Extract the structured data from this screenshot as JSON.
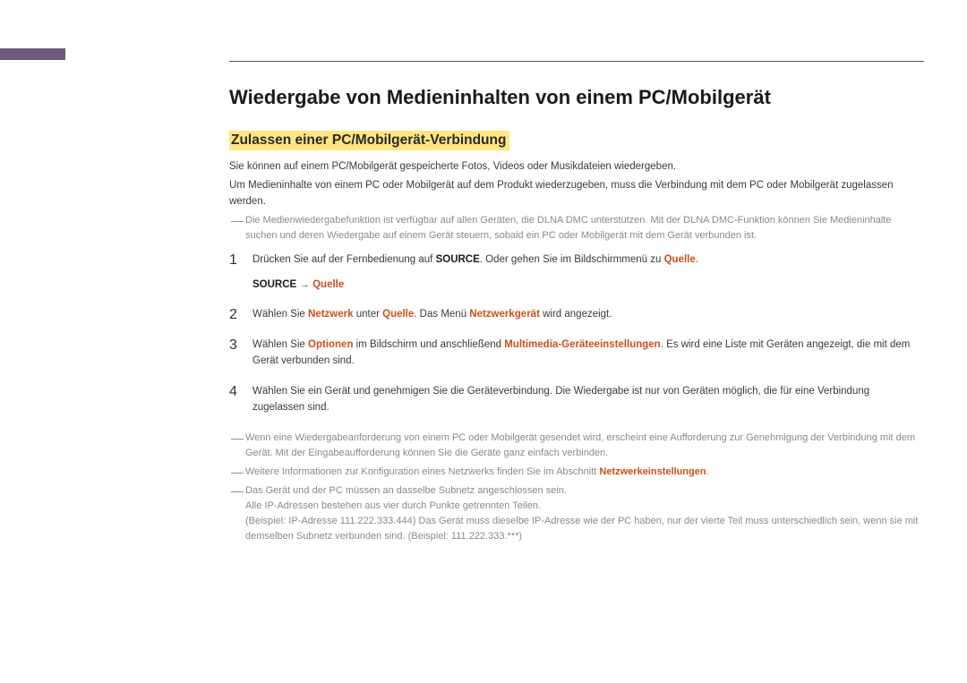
{
  "heading": "Wiedergabe von Medieninhalten von einem PC/Mobilgerät",
  "subheading": "Zulassen einer PC/Mobilgerät-Verbindung",
  "intro1": "Sie können auf einem PC/Mobilgerät gespeicherte Fotos, Videos oder Musikdateien wiedergeben.",
  "intro2": "Um Medieninhalte von einem PC oder Mobilgerät auf dem Produkt wiederzugeben, muss die Verbindung mit dem PC oder Mobilgerät zugelassen werden.",
  "top_note": "Die Medienwiedergabefunktion ist verfügbar auf allen Geräten, die DLNA DMC unterstützen. Mit der DLNA DMC-Funktion können Sie Medieninhalte suchen und deren Wiedergabe auf einem Gerät steuern, sobald ein PC oder Mobilgerät mit dem Gerät verbunden ist.",
  "steps": [
    {
      "num": "1",
      "pre": "Drücken Sie auf der Fernbedienung auf ",
      "bold1": "SOURCE",
      "mid": ". Oder gehen Sie im Bildschirmmenü zu ",
      "hl1": "Quelle",
      "post": ".",
      "path_bold": "SOURCE",
      "path_arrow": " → ",
      "path_hl": "Quelle"
    },
    {
      "num": "2",
      "pre": "Wählen Sie ",
      "hl1": "Netzwerk",
      "mid": " unter ",
      "hl2": "Quelle",
      "mid2": ". Das Menü ",
      "hl3": "Netzwerkgerät",
      "post": " wird angezeigt."
    },
    {
      "num": "3",
      "pre": "Wählen Sie ",
      "hl1": "Optionen",
      "mid": " im Bildschirm und anschließend ",
      "hl2": "Multimedia-Geräteeinstellungen",
      "post": ". Es wird eine Liste mit Geräten angezeigt, die mit dem Gerät verbunden sind."
    },
    {
      "num": "4",
      "text": "Wählen Sie ein Gerät und genehmigen Sie die Geräteverbindung. Die Wiedergabe ist nur von Geräten möglich, die für eine Verbindung zugelassen sind."
    }
  ],
  "footer_notes": [
    {
      "line1": "Wenn eine Wiedergabeanforderung von einem PC oder Mobilgerät gesendet wird, erscheint eine Aufforderung zur Genehmigung der Verbindung mit dem Gerät. Mit der Eingabeaufforderung können Sie die Geräte ganz einfach verbinden."
    },
    {
      "pre": "Weitere Informationen zur Konfiguration eines Netzwerks finden Sie im Abschnitt ",
      "hl": "Netzwerkeinstellungen",
      "post": "."
    },
    {
      "line1": "Das Gerät und der PC müssen an dasselbe Subnetz angeschlossen sein.",
      "line2": "Alle IP-Adressen bestehen aus vier durch Punkte getrennten Teilen.",
      "line3": "(Beispiel: IP-Adresse 111.222.333.444) Das Gerät muss dieselbe IP-Adresse wie der PC haben, nur der vierte Teil muss unterschiedlich sein, wenn sie mit demselben Subnetz verbunden sind. (Beispiel: 111.222.333.***)"
    }
  ]
}
